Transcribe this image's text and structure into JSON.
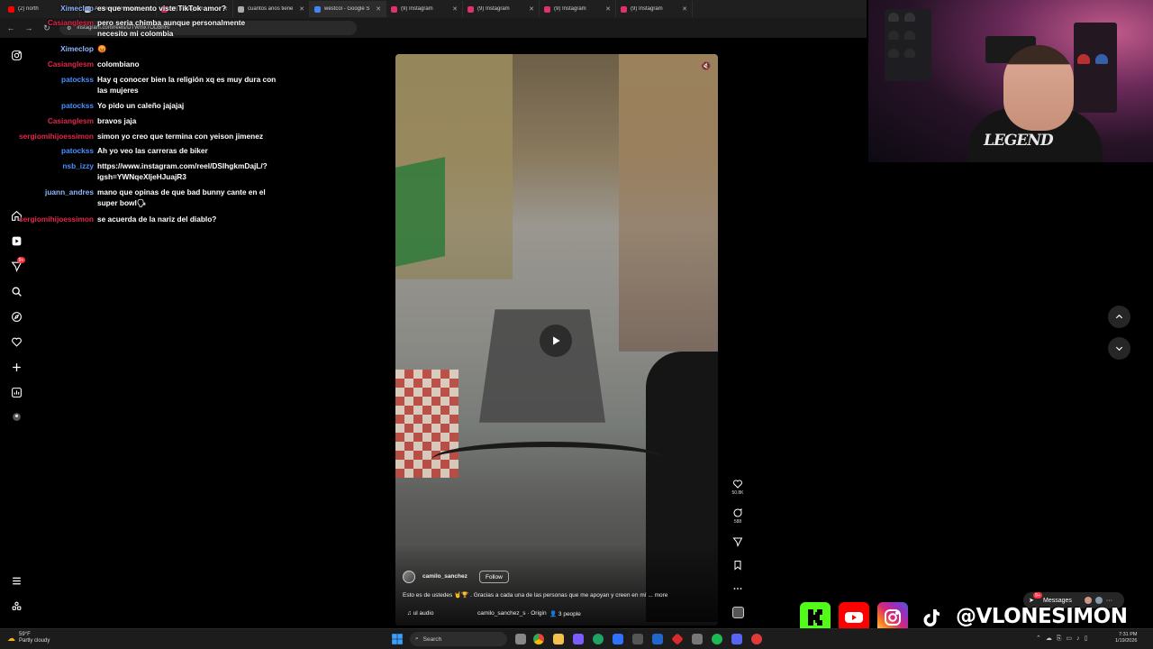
{
  "browser": {
    "tabs": [
      {
        "label": "(2) north",
        "color": "#ff0000"
      },
      {
        "label": "Archivo VAR on X",
        "color": "#ffffff"
      },
      {
        "label": "(9) Instagram",
        "color": "#e1306c"
      },
      {
        "label": "cuantos anos tiene",
        "color": "#aaaaaa"
      },
      {
        "label": "westcol - Google S",
        "color": "#4285f4"
      },
      {
        "label": "(9) Instagram",
        "color": "#e1306c"
      },
      {
        "label": "(9) Instagram",
        "color": "#e1306c"
      },
      {
        "label": "(9) Instagram",
        "color": "#e1306c"
      },
      {
        "label": "(9) Instagram",
        "color": "#e1306c"
      }
    ],
    "url": "instagram.com/reels/DTWmxTODBhR/"
  },
  "chat": [
    {
      "user": "Ximeclop",
      "color": "#8fb6ff",
      "msg": "es que momento viste TikTok amor?"
    },
    {
      "user": "Casianglesm",
      "color": "#e0284a",
      "msg": "pero seria chimba aunque personalmente necesito mi colombia"
    },
    {
      "user": "Ximeclop",
      "color": "#8fb6ff",
      "msg": "😡"
    },
    {
      "user": "Casianglesm",
      "color": "#e0284a",
      "msg": "colombiano"
    },
    {
      "user": "patockss",
      "color": "#4a90ff",
      "msg": "Hay q conocer bien la religión xq es muy dura con las mujeres"
    },
    {
      "user": "patockss",
      "color": "#4a90ff",
      "msg": "Yo pido un caleño jajajaj"
    },
    {
      "user": "Casianglesm",
      "color": "#e0284a",
      "msg": "bravos jaja"
    },
    {
      "user": "sergiomihijoessimon",
      "color": "#e0284a",
      "msg": "simon yo creo que termina con yeison jimenez"
    },
    {
      "user": "patockss",
      "color": "#4a90ff",
      "msg": "Ah yo veo las carreras de biker"
    },
    {
      "user": "nsb_izzy",
      "color": "#4a90ff",
      "msg": "https://www.instagram.com/reel/DSIhgkmDajL/?igsh=YWNqeXljeHJuajR3"
    },
    {
      "user": "juann_andres",
      "color": "#8fb6ff",
      "msg": "mano que opinas de que bad bunny cante en el super bowl🗣"
    },
    {
      "user": "sergiomihijoessimon",
      "color": "#e0284a",
      "msg": "se acuerda de la nariz del diablo?"
    }
  ],
  "reel": {
    "author": "camilo_sanchez",
    "follow_label": "Follow",
    "caption": "Esto es de ustedes 🤘🏆 . Gracias a cada una de las personas que me apoyan y creen en mí ... more",
    "audio": "ul audio",
    "original_audio": "camilo_sanchez_s · Origin",
    "tagged": "3 people",
    "likes": "50.8K",
    "comments": "588"
  },
  "messages": {
    "label": "Messages",
    "badge": "9+"
  },
  "nav_badge": "9+",
  "social_handle": "@VLONESIMON",
  "taskbar": {
    "weather_temp": "59°F",
    "weather_desc": "Partly cloudy",
    "search_placeholder": "Search",
    "time": "7:31 PM",
    "date": "1/19/2026"
  },
  "icons": [
    "instagram-icon",
    "home-icon",
    "reels-icon",
    "send-icon",
    "search-icon",
    "explore-icon",
    "heart-icon",
    "plus-icon",
    "dashboard-icon",
    "profile-icon",
    "menu-icon",
    "more-icon",
    "play-icon",
    "mute-icon",
    "like-icon",
    "comment-icon",
    "share-icon",
    "save-icon",
    "audio-icon",
    "chevron-up-icon",
    "chevron-down-icon",
    "kick-icon",
    "youtube-icon",
    "tiktok-icon",
    "windows-icon"
  ]
}
